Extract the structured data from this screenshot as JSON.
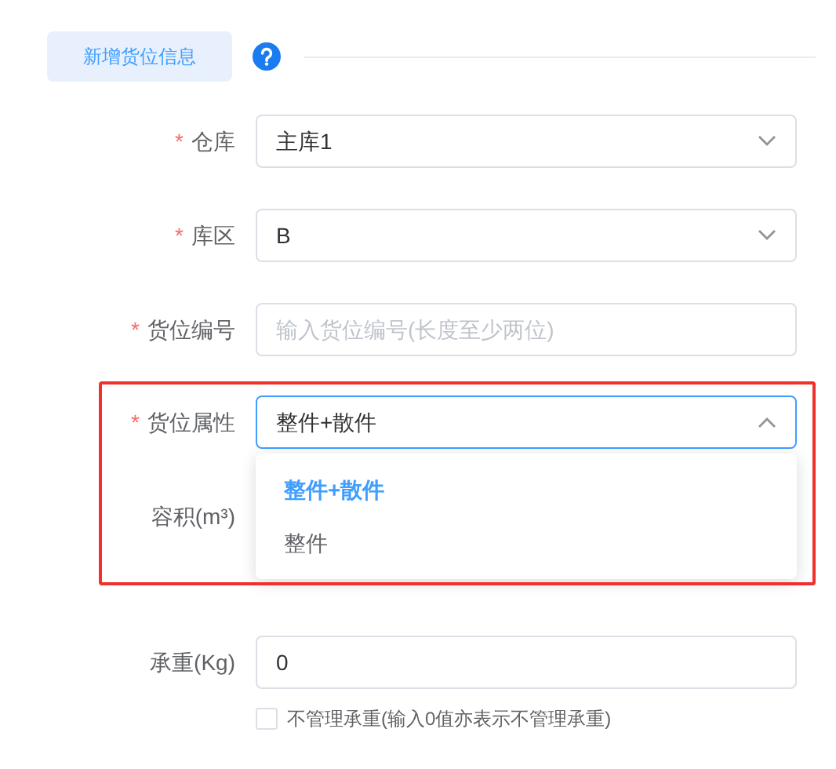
{
  "header": {
    "title": "新增货位信息"
  },
  "fields": [
    {
      "kind": "select",
      "label": "仓库",
      "required_mark": "*",
      "value": "主库1",
      "expanded": false,
      "highlighted": false
    },
    {
      "kind": "select",
      "label": "库区",
      "required_mark": "*",
      "value": "B",
      "expanded": false,
      "highlighted": false
    },
    {
      "kind": "input",
      "label": "货位编号",
      "required_mark": "*",
      "placeholder": "输入货位编号(长度至少两位)"
    },
    {
      "kind": "select",
      "label": "货位属性",
      "required_mark": "*",
      "value": "整件+散件",
      "expanded": true,
      "highlighted": true,
      "options": [
        {
          "label": "整件+散件",
          "selected": true
        },
        {
          "label": "整件",
          "selected": false
        }
      ]
    },
    {
      "kind": "covered",
      "label": "容积(m³)"
    },
    {
      "kind": "input",
      "label": "承重(Kg)",
      "value": "0",
      "checkbox": {
        "label": "不管理承重(输入0值亦表示不管理承重)",
        "checked": false
      }
    }
  ]
}
